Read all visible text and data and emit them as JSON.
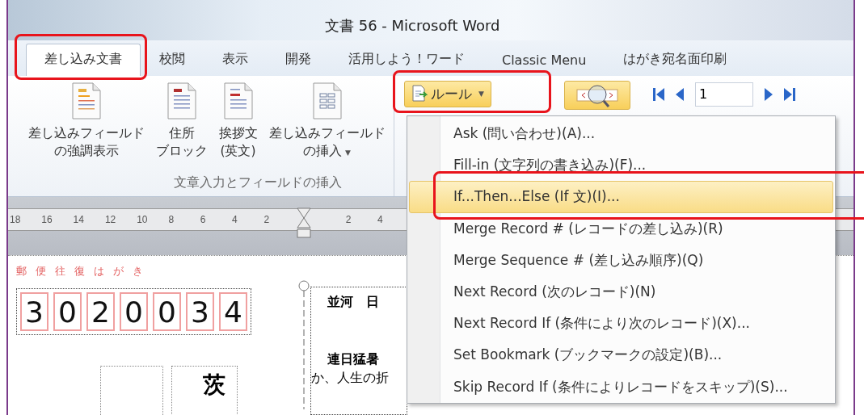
{
  "window": {
    "title": "文書 56 - Microsoft Word"
  },
  "tabs": [
    {
      "label": "差し込み文書",
      "selected": true,
      "callout": true
    },
    {
      "label": "校閲",
      "selected": false,
      "callout": false
    },
    {
      "label": "表示",
      "selected": false,
      "callout": false
    },
    {
      "label": "開発",
      "selected": false,
      "callout": false
    },
    {
      "label": "活用しよう！ワード",
      "selected": false,
      "callout": false
    },
    {
      "label": "Classic Menu",
      "selected": false,
      "callout": false
    },
    {
      "label": "はがき宛名面印刷",
      "selected": false,
      "callout": false
    }
  ],
  "ribbon": {
    "buttons": [
      {
        "lines": [
          "差し込みフィールド",
          "の強調表示"
        ],
        "kind": "highlight"
      },
      {
        "lines": [
          "住所",
          "ブロック"
        ],
        "kind": "address"
      },
      {
        "lines": [
          "挨拶文",
          "(英文)"
        ],
        "kind": "greeting"
      },
      {
        "lines": [
          "差し込みフィールド",
          "の挿入"
        ],
        "kind": "insert",
        "caret": "▼"
      }
    ],
    "group_label": "文章入力とフィールドの挿入",
    "rules_button": {
      "label": "ルール",
      "caret": "▼",
      "pressed": true,
      "callout": true
    },
    "preview_button": {
      "pressed": true
    },
    "record_field": {
      "value": "1"
    }
  },
  "ruler": {
    "left_labels": [
      "18",
      "16",
      "14",
      "12",
      "10",
      "8",
      "6",
      "4",
      "2"
    ],
    "right_labels": [
      "2",
      "4"
    ]
  },
  "document": {
    "card_label": "郵便往復はがき",
    "postal_digits": [
      "3",
      "0",
      "2",
      "0",
      "0",
      "3",
      "4"
    ],
    "address_char": "茨",
    "letter_lines": [
      {
        "text": "並河　日",
        "kind": "name"
      },
      {
        "text": "連日猛暑",
        "kind": "body"
      },
      {
        "text": "か、人生の折",
        "kind": "body_plain"
      }
    ]
  },
  "menu": {
    "items": [
      {
        "label": "Ask (問い合わせ)(A)...",
        "selected": false,
        "callout": false
      },
      {
        "label": "Fill-in (文字列の書き込み)(F)...",
        "selected": false,
        "callout": false
      },
      {
        "label": "If...Then...Else (If 文)(I)...",
        "selected": true,
        "callout": true
      },
      {
        "label": "Merge Record # (レコードの差し込み)(R)",
        "selected": false,
        "callout": false
      },
      {
        "label": "Merge Sequence # (差し込み順序)(Q)",
        "selected": false,
        "callout": false
      },
      {
        "label": "Next Record (次のレコード)(N)",
        "selected": false,
        "callout": false
      },
      {
        "label": "Next Record If (条件により次のレコード)(X)...",
        "selected": false,
        "callout": false
      },
      {
        "label": "Set Bookmark (ブックマークの設定)(B)...",
        "selected": false,
        "callout": false
      },
      {
        "label": "Skip Record If (条件によりレコードをスキップ)(S)...",
        "selected": false,
        "callout": false
      }
    ]
  }
}
